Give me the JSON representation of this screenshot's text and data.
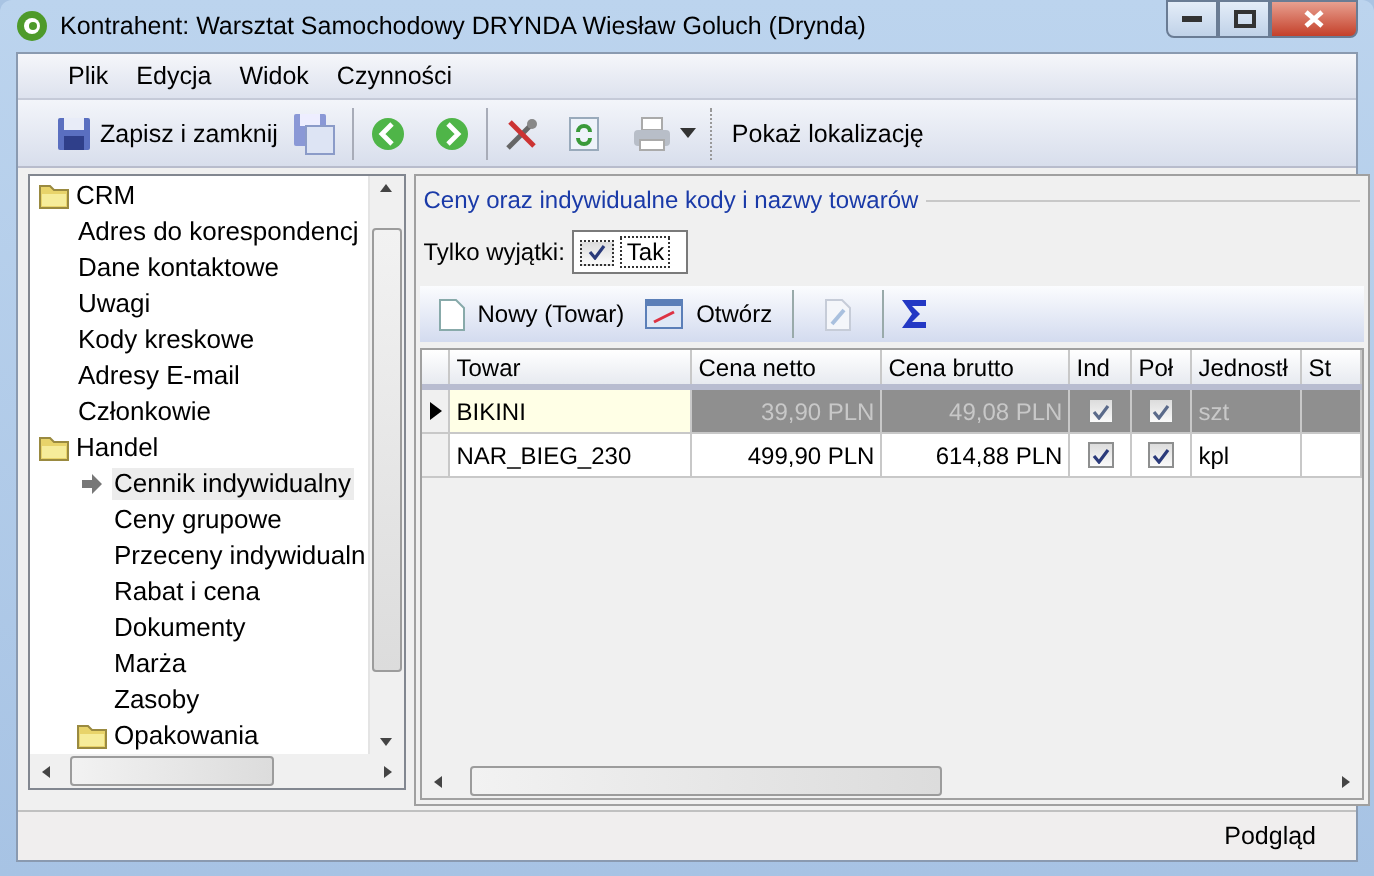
{
  "window": {
    "title": "Kontrahent: Warsztat Samochodowy DRYNDA Wiesław Goluch (Drynda)"
  },
  "menu": [
    "Plik",
    "Edycja",
    "Widok",
    "Czynności"
  ],
  "toolbar": {
    "save_close": "Zapisz i zamknij",
    "show_location": "Pokaż lokalizację"
  },
  "tree": [
    {
      "label": "CRM",
      "kind": "folder",
      "selected": false,
      "children": [
        {
          "label": "Adres do korespondencj",
          "kind": "item",
          "selected": false
        },
        {
          "label": "Dane kontaktowe",
          "kind": "item",
          "selected": false
        },
        {
          "label": "Uwagi",
          "kind": "item",
          "selected": false
        },
        {
          "label": "Kody kreskowe",
          "kind": "item",
          "selected": false
        },
        {
          "label": "Adresy E-mail",
          "kind": "item",
          "selected": false
        },
        {
          "label": "Członkowie",
          "kind": "item",
          "selected": false
        }
      ]
    },
    {
      "label": "Handel",
      "kind": "folder",
      "selected": false,
      "children": [
        {
          "label": "Cennik indywidualny",
          "kind": "item",
          "selected": true
        },
        {
          "label": "Ceny grupowe",
          "kind": "item",
          "selected": false
        },
        {
          "label": "Przeceny indywidualn",
          "kind": "item",
          "selected": false
        },
        {
          "label": "Rabat i cena",
          "kind": "item",
          "selected": false
        },
        {
          "label": "Dokumenty",
          "kind": "item",
          "selected": false
        },
        {
          "label": "Marża",
          "kind": "item",
          "selected": false
        },
        {
          "label": "Zasoby",
          "kind": "item",
          "selected": false
        },
        {
          "label": "Opakowania",
          "kind": "folder",
          "selected": false
        }
      ]
    }
  ],
  "panel": {
    "title": "Ceny oraz indywidualne kody i nazwy towarów",
    "filter": {
      "label": "Tylko wyjątki:",
      "checked": true,
      "value": "Tak"
    },
    "toolbar": {
      "new": "Nowy (Towar)",
      "open": "Otwórz"
    },
    "table": {
      "columns": [
        {
          "label": "Towar",
          "kind": "text"
        },
        {
          "label": "Cena netto",
          "kind": "number"
        },
        {
          "label": "Cena brutto",
          "kind": "number"
        },
        {
          "label": "Ind",
          "kind": "check"
        },
        {
          "label": "Poł",
          "kind": "check"
        },
        {
          "label": "Jednostł",
          "kind": "text"
        },
        {
          "label": "St",
          "kind": "text"
        }
      ],
      "rows": [
        {
          "selected": true,
          "cells": [
            "BIKINI",
            "39,90 PLN",
            "49,08 PLN",
            true,
            true,
            "szt"
          ]
        },
        {
          "selected": false,
          "cells": [
            "NAR_BIEG_230",
            "499,90 PLN",
            "614,88 PLN",
            true,
            true,
            "kpl"
          ]
        }
      ]
    }
  },
  "status_bar": {
    "text": "Podgląd"
  }
}
